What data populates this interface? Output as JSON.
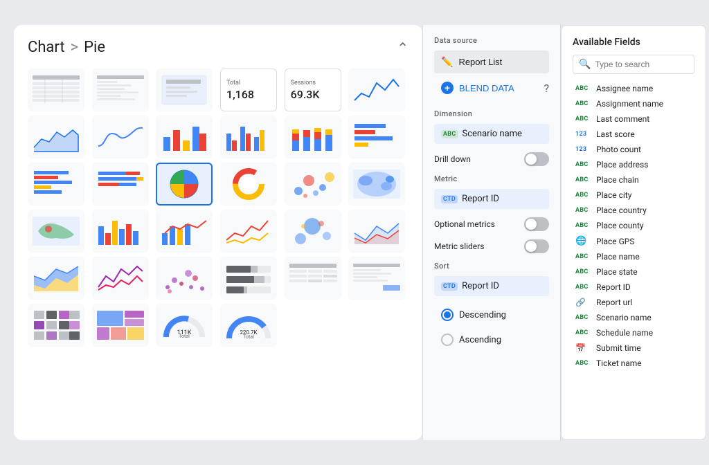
{
  "chartPanel": {
    "title": "Chart",
    "separator": ">",
    "current": "Pie",
    "stats": [
      {
        "label": "Total",
        "value": "1,168"
      },
      {
        "label": "Sessions",
        "value": "69.3K"
      }
    ]
  },
  "configPanel": {
    "dataSourceLabel": "Data source",
    "dataSourceName": "Report List",
    "blendLabel": "BLEND DATA",
    "dimensionLabel": "Dimension",
    "dimensionField": "Scenario name",
    "dimensionType": "ABC",
    "drillDownLabel": "Drill down",
    "metricLabel": "Metric",
    "metricField": "Report ID",
    "metricType": "CTD",
    "optionalMetricsLabel": "Optional metrics",
    "metricSlidersLabel": "Metric sliders",
    "sortLabel": "Sort",
    "sortField": "Report ID",
    "sortType": "CTD",
    "descendingLabel": "Descending",
    "ascendingLabel": "Ascending"
  },
  "fieldsPanel": {
    "title": "Available Fields",
    "searchPlaceholder": "Type to search",
    "fields": [
      {
        "type": "ABC",
        "name": "Assignee name",
        "typeClass": "abc"
      },
      {
        "type": "ABC",
        "name": "Assignment name",
        "typeClass": "abc"
      },
      {
        "type": "ABC",
        "name": "Last comment",
        "typeClass": "abc"
      },
      {
        "type": "123",
        "name": "Last score",
        "typeClass": "num"
      },
      {
        "type": "123",
        "name": "Photo count",
        "typeClass": "num"
      },
      {
        "type": "ABC",
        "name": "Place address",
        "typeClass": "abc"
      },
      {
        "type": "ABC",
        "name": "Place chain",
        "typeClass": "abc"
      },
      {
        "type": "ABC",
        "name": "Place city",
        "typeClass": "abc"
      },
      {
        "type": "ABC",
        "name": "Place country",
        "typeClass": "abc"
      },
      {
        "type": "ABC",
        "name": "Place county",
        "typeClass": "abc"
      },
      {
        "type": "GPS",
        "name": "Place GPS",
        "typeClass": "icon"
      },
      {
        "type": "ABC",
        "name": "Place name",
        "typeClass": "abc"
      },
      {
        "type": "ABC",
        "name": "Place state",
        "typeClass": "abc"
      },
      {
        "type": "ABC",
        "name": "Report ID",
        "typeClass": "abc"
      },
      {
        "type": "URL",
        "name": "Report url",
        "typeClass": "link"
      },
      {
        "type": "ABC",
        "name": "Scenario name",
        "typeClass": "abc"
      },
      {
        "type": "ABC",
        "name": "Schedule name",
        "typeClass": "abc"
      },
      {
        "type": "CAL",
        "name": "Submit time",
        "typeClass": "cal"
      },
      {
        "type": "ABC",
        "name": "Ticket name",
        "typeClass": "abc"
      }
    ]
  }
}
